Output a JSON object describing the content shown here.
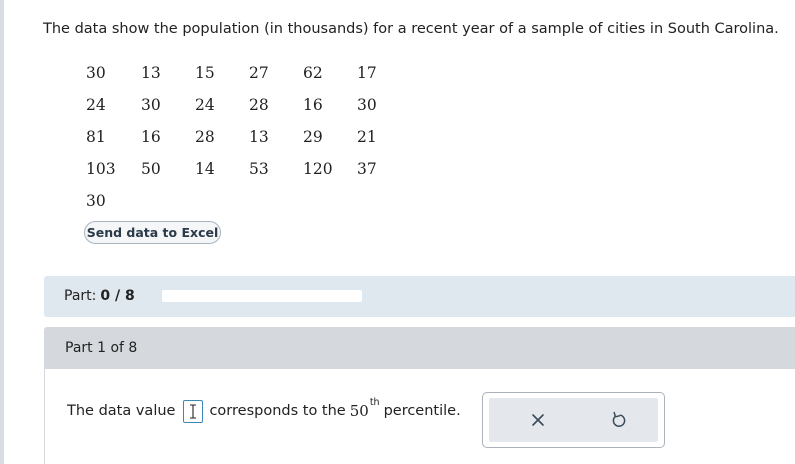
{
  "problem": {
    "intro": "The data show the population (in thousands) for a recent year of a sample of cities in South Carolina.",
    "data_rows": [
      [
        "30",
        "13",
        "15",
        "27",
        "62",
        "17"
      ],
      [
        "24",
        "30",
        "24",
        "28",
        "16",
        "30"
      ],
      [
        "81",
        "16",
        "28",
        "13",
        "29",
        "21"
      ],
      [
        "103",
        "50",
        "14",
        "53",
        "120",
        "37"
      ],
      [
        "30",
        "",
        "",
        "",
        "",
        ""
      ]
    ],
    "excel_button_label": "Send data to Excel"
  },
  "progress": {
    "label": "Part:",
    "count": "0 / 8",
    "completed": 0,
    "total": 8
  },
  "part": {
    "title": "Part 1 of 8",
    "question_prefix": "The data value",
    "question_middle": "corresponds to the",
    "percentile_value": "50",
    "percentile_suffix": "th",
    "question_end": "percentile.",
    "answer_value": ""
  },
  "actions": {
    "clear_icon": "close-icon",
    "undo_icon": "undo-icon"
  },
  "colors": {
    "progress_panel": "#dfe7ef",
    "part_header": "#d5d9dd",
    "input_border": "#3a87b8",
    "action_panel": "#e4e8ec",
    "icon": "#3a4a58"
  }
}
